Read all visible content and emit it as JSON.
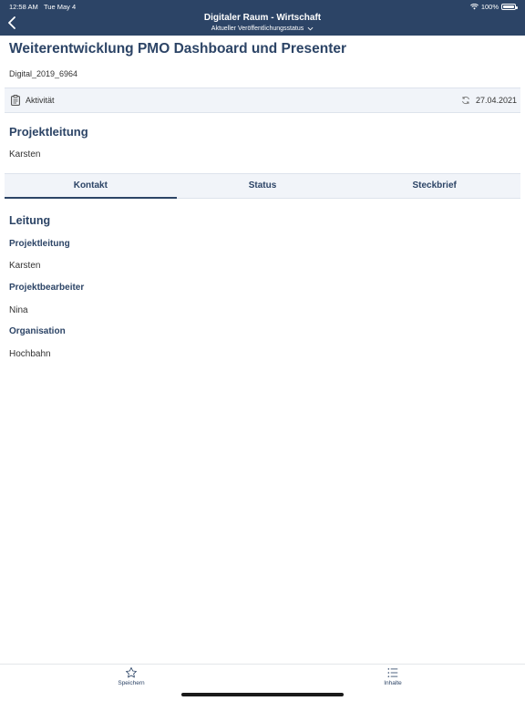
{
  "status_bar": {
    "time": "12:58 AM",
    "date": "Tue May 4",
    "battery": "100%"
  },
  "header": {
    "title": "Digitaler Raum - Wirtschaft",
    "subtitle": "Aktueller Veröffentlichungsstatus"
  },
  "page": {
    "title": "Weiterentwicklung PMO Dashboard und Presenter",
    "doc_id": "Digital_2019_6964"
  },
  "activity": {
    "label": "Aktivität",
    "date": "27.04.2021"
  },
  "projektleitung": {
    "heading": "Projektleitung",
    "value": "Karsten"
  },
  "tabs": [
    {
      "label": "Kontakt",
      "active": true
    },
    {
      "label": "Status",
      "active": false
    },
    {
      "label": "Steckbrief",
      "active": false
    }
  ],
  "contact": {
    "heading": "Leitung",
    "fields": [
      {
        "label": "Projektleitung",
        "value": "Karsten"
      },
      {
        "label": "Projektbearbeiter",
        "value": "Nina"
      },
      {
        "label": "Organisation",
        "value": "Hochbahn"
      }
    ]
  },
  "bottom_bar": {
    "save_label": "Speichern",
    "contents_label": "Inhalte"
  },
  "colors": {
    "primary": "#2c4466",
    "bar_bg": "#f1f4f9"
  },
  "icons": [
    "back-chevron-icon",
    "clipboard-icon",
    "sync-icon",
    "star-icon",
    "list-icon",
    "wifi-icon",
    "battery-icon"
  ]
}
